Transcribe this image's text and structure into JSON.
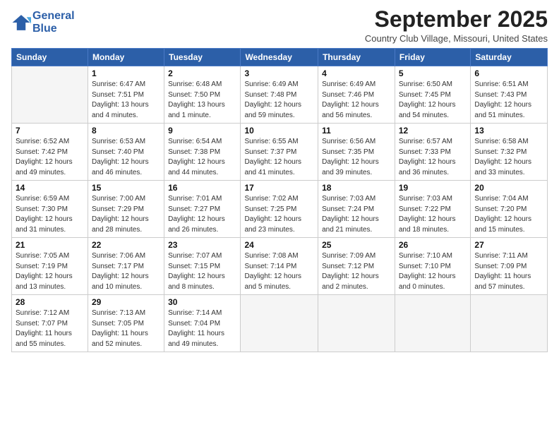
{
  "logo": {
    "line1": "General",
    "line2": "Blue"
  },
  "title": "September 2025",
  "location": "Country Club Village, Missouri, United States",
  "days_header": [
    "Sunday",
    "Monday",
    "Tuesday",
    "Wednesday",
    "Thursday",
    "Friday",
    "Saturday"
  ],
  "weeks": [
    [
      {
        "num": "",
        "info": ""
      },
      {
        "num": "1",
        "info": "Sunrise: 6:47 AM\nSunset: 7:51 PM\nDaylight: 13 hours\nand 4 minutes."
      },
      {
        "num": "2",
        "info": "Sunrise: 6:48 AM\nSunset: 7:50 PM\nDaylight: 13 hours\nand 1 minute."
      },
      {
        "num": "3",
        "info": "Sunrise: 6:49 AM\nSunset: 7:48 PM\nDaylight: 12 hours\nand 59 minutes."
      },
      {
        "num": "4",
        "info": "Sunrise: 6:49 AM\nSunset: 7:46 PM\nDaylight: 12 hours\nand 56 minutes."
      },
      {
        "num": "5",
        "info": "Sunrise: 6:50 AM\nSunset: 7:45 PM\nDaylight: 12 hours\nand 54 minutes."
      },
      {
        "num": "6",
        "info": "Sunrise: 6:51 AM\nSunset: 7:43 PM\nDaylight: 12 hours\nand 51 minutes."
      }
    ],
    [
      {
        "num": "7",
        "info": "Sunrise: 6:52 AM\nSunset: 7:42 PM\nDaylight: 12 hours\nand 49 minutes."
      },
      {
        "num": "8",
        "info": "Sunrise: 6:53 AM\nSunset: 7:40 PM\nDaylight: 12 hours\nand 46 minutes."
      },
      {
        "num": "9",
        "info": "Sunrise: 6:54 AM\nSunset: 7:38 PM\nDaylight: 12 hours\nand 44 minutes."
      },
      {
        "num": "10",
        "info": "Sunrise: 6:55 AM\nSunset: 7:37 PM\nDaylight: 12 hours\nand 41 minutes."
      },
      {
        "num": "11",
        "info": "Sunrise: 6:56 AM\nSunset: 7:35 PM\nDaylight: 12 hours\nand 39 minutes."
      },
      {
        "num": "12",
        "info": "Sunrise: 6:57 AM\nSunset: 7:33 PM\nDaylight: 12 hours\nand 36 minutes."
      },
      {
        "num": "13",
        "info": "Sunrise: 6:58 AM\nSunset: 7:32 PM\nDaylight: 12 hours\nand 33 minutes."
      }
    ],
    [
      {
        "num": "14",
        "info": "Sunrise: 6:59 AM\nSunset: 7:30 PM\nDaylight: 12 hours\nand 31 minutes."
      },
      {
        "num": "15",
        "info": "Sunrise: 7:00 AM\nSunset: 7:29 PM\nDaylight: 12 hours\nand 28 minutes."
      },
      {
        "num": "16",
        "info": "Sunrise: 7:01 AM\nSunset: 7:27 PM\nDaylight: 12 hours\nand 26 minutes."
      },
      {
        "num": "17",
        "info": "Sunrise: 7:02 AM\nSunset: 7:25 PM\nDaylight: 12 hours\nand 23 minutes."
      },
      {
        "num": "18",
        "info": "Sunrise: 7:03 AM\nSunset: 7:24 PM\nDaylight: 12 hours\nand 21 minutes."
      },
      {
        "num": "19",
        "info": "Sunrise: 7:03 AM\nSunset: 7:22 PM\nDaylight: 12 hours\nand 18 minutes."
      },
      {
        "num": "20",
        "info": "Sunrise: 7:04 AM\nSunset: 7:20 PM\nDaylight: 12 hours\nand 15 minutes."
      }
    ],
    [
      {
        "num": "21",
        "info": "Sunrise: 7:05 AM\nSunset: 7:19 PM\nDaylight: 12 hours\nand 13 minutes."
      },
      {
        "num": "22",
        "info": "Sunrise: 7:06 AM\nSunset: 7:17 PM\nDaylight: 12 hours\nand 10 minutes."
      },
      {
        "num": "23",
        "info": "Sunrise: 7:07 AM\nSunset: 7:15 PM\nDaylight: 12 hours\nand 8 minutes."
      },
      {
        "num": "24",
        "info": "Sunrise: 7:08 AM\nSunset: 7:14 PM\nDaylight: 12 hours\nand 5 minutes."
      },
      {
        "num": "25",
        "info": "Sunrise: 7:09 AM\nSunset: 7:12 PM\nDaylight: 12 hours\nand 2 minutes."
      },
      {
        "num": "26",
        "info": "Sunrise: 7:10 AM\nSunset: 7:10 PM\nDaylight: 12 hours\nand 0 minutes."
      },
      {
        "num": "27",
        "info": "Sunrise: 7:11 AM\nSunset: 7:09 PM\nDaylight: 11 hours\nand 57 minutes."
      }
    ],
    [
      {
        "num": "28",
        "info": "Sunrise: 7:12 AM\nSunset: 7:07 PM\nDaylight: 11 hours\nand 55 minutes."
      },
      {
        "num": "29",
        "info": "Sunrise: 7:13 AM\nSunset: 7:05 PM\nDaylight: 11 hours\nand 52 minutes."
      },
      {
        "num": "30",
        "info": "Sunrise: 7:14 AM\nSunset: 7:04 PM\nDaylight: 11 hours\nand 49 minutes."
      },
      {
        "num": "",
        "info": ""
      },
      {
        "num": "",
        "info": ""
      },
      {
        "num": "",
        "info": ""
      },
      {
        "num": "",
        "info": ""
      }
    ]
  ]
}
